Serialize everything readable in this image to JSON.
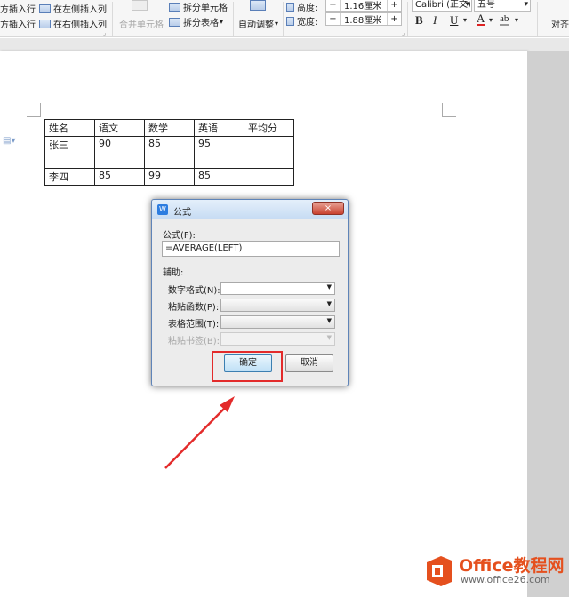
{
  "ribbon": {
    "insert_above": "方插入行",
    "insert_below": "方插入行",
    "insert_left": "在左侧插入列",
    "insert_right": "在右侧插入列",
    "merge_cells": "合并单元格",
    "split_cells": "拆分单元格",
    "split_table": "拆分表格",
    "auto_fit": "自动调整",
    "height_label": "高度:",
    "height_value": "1.16厘米",
    "width_label": "宽度:",
    "width_value": "1.88厘米",
    "font_name": "Calibri (正文)",
    "font_size": "五号",
    "align": "对齐"
  },
  "table": {
    "rows": [
      [
        "姓名",
        "语文",
        "数学",
        "英语",
        "平均分"
      ],
      [
        "张三",
        "90",
        "85",
        "95",
        ""
      ],
      [
        "李四",
        "85",
        "99",
        "85",
        ""
      ]
    ]
  },
  "dialog": {
    "title": "公式",
    "close_label": "×",
    "formula_label": "公式(F):",
    "formula_value": "=AVERAGE(LEFT)",
    "helper_label": "辅助:",
    "number_format_label": "数字格式(N):",
    "paste_function_label": "粘贴函数(P):",
    "table_range_label": "表格范围(T):",
    "paste_bookmark_label": "粘贴书签(B):",
    "ok_label": "确定",
    "cancel_label": "取消"
  },
  "watermark": {
    "brand": "Office教程网",
    "url": "www.office26.com"
  },
  "colors": {
    "highlight": "#e32b2b",
    "brand": "#e5501e"
  }
}
